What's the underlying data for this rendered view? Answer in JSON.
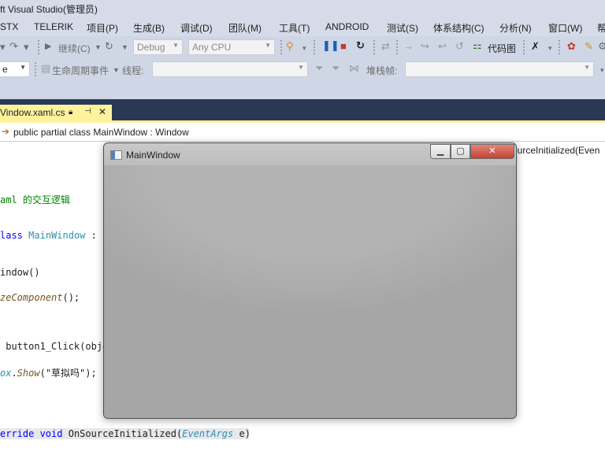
{
  "ide": {
    "title": "ft Visual Studio(管理员)",
    "menu": [
      "STX",
      "TELERIK",
      "项目(P)",
      "生成(B)",
      "调试(D)",
      "团队(M)",
      "工具(T)",
      "ANDROID",
      "测试(S)",
      "体系结构(C)",
      "分析(N)",
      "窗口(W)",
      "帮"
    ],
    "toolbar": {
      "continue_label": "继续(C)",
      "config_value": "Debug",
      "platform_value": "Any CPU",
      "code_map_label": "代码图",
      "lifecycle_label": "生命周期事件",
      "thread_label": "线程:",
      "stack_label": "堆栈帧:",
      "left_combo_value": "e"
    },
    "tab": {
      "label": "Vindow.xaml.cs"
    },
    "navbar": {
      "type_crumb": "public partial class MainWindow : Window",
      "member_crumb": "ourceInitialized(Even"
    }
  },
  "code": {
    "line1": "aml 的交互逻辑",
    "line2_kw": "lass",
    "line2_type": "MainWindow",
    "line2_colon": ":",
    "line3": "indow()",
    "line4_method": "zeComponent",
    "line4_rest": "();",
    "line5_name": "button1_Click(obje",
    "line6_a": "ox",
    "line6_b": ".",
    "line6_c": "Show",
    "line6_d": "(\"草拟吗\");",
    "line7_kw": "erride void",
    "line7_name": "OnSourceInitialized(",
    "line7_type": "EventArgs",
    "line7_rest": "e)"
  },
  "main_window": {
    "title": "MainWindow",
    "min_glyph": "▁",
    "max_glyph": "▢",
    "close_glyph": "✕"
  }
}
